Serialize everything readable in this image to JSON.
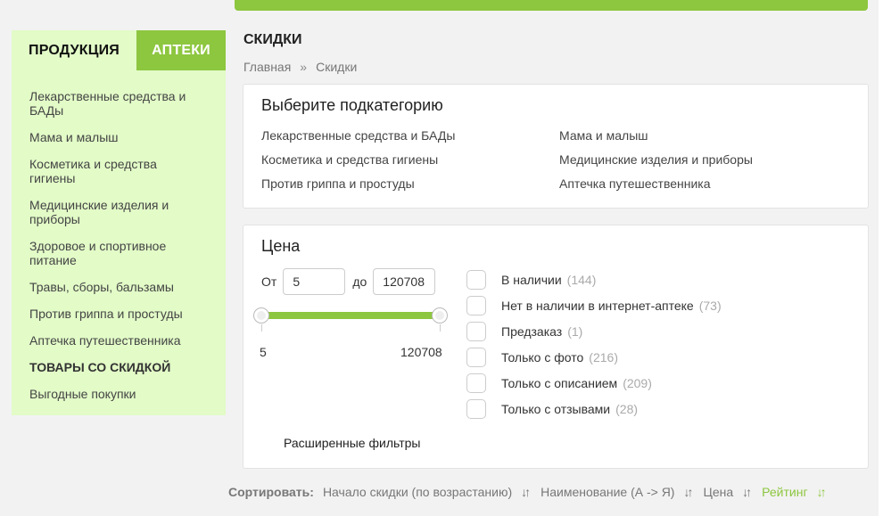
{
  "sidebar": {
    "tabs": [
      {
        "label": "ПРОДУКЦИЯ",
        "active": true
      },
      {
        "label": "АПТЕКИ",
        "active": false
      }
    ],
    "items": [
      {
        "label": "Лекарственные средства и БАДы"
      },
      {
        "label": "Мама и малыш"
      },
      {
        "label": "Косметика и средства гигиены"
      },
      {
        "label": "Медицинские изделия и приборы"
      },
      {
        "label": "Здоровое и спортивное питание"
      },
      {
        "label": "Травы, сборы, бальзамы"
      },
      {
        "label": "Против гриппа и простуды"
      },
      {
        "label": "Аптечка путешественника"
      },
      {
        "label": "ТОВАРЫ СО СКИДКОЙ"
      },
      {
        "label": "Выгодные покупки"
      }
    ]
  },
  "page": {
    "title": "СКИДКИ",
    "breadcrumb": [
      "Главная",
      "»",
      "Скидки"
    ]
  },
  "subcategories": {
    "title": "Выберите подкатегорию",
    "items": [
      "Лекарственные средства и БАДы",
      "Мама и малыш",
      "Косметика и средства гигиены",
      "Медицинские изделия и приборы",
      "Против гриппа и простуды",
      "Аптечка путешественника"
    ]
  },
  "price": {
    "title": "Цена",
    "from_label": "От",
    "to_label": "до",
    "from_value": "5",
    "to_value": "120708",
    "slider_min": "5",
    "slider_max": "120708",
    "advanced_filters": "Расширенные фильтры"
  },
  "filters": [
    {
      "label": "В наличии",
      "count": "(144)",
      "checked": false
    },
    {
      "label": "Нет в наличии в интернет-аптеке",
      "count": "(73)",
      "checked": false
    },
    {
      "label": "Предзаказ",
      "count": "(1)",
      "checked": false
    },
    {
      "label": "Только с фото",
      "count": "(216)",
      "checked": false
    },
    {
      "label": "Только с описанием",
      "count": "(209)",
      "checked": false
    },
    {
      "label": "Только с отзывами",
      "count": "(28)",
      "checked": false
    }
  ],
  "sort": {
    "label": "Сортировать:",
    "options": [
      {
        "label": "Начало скидки (по возрастанию)",
        "active": false
      },
      {
        "label": "Наименование (А -> Я)",
        "active": false
      },
      {
        "label": "Цена",
        "active": false
      },
      {
        "label": "Рейтинг",
        "active": true
      }
    ],
    "arrow_icon": "sort-arrows-icon"
  },
  "colors": {
    "accent": "#8dc63f",
    "sidebar_bg": "#e2fbc7"
  }
}
